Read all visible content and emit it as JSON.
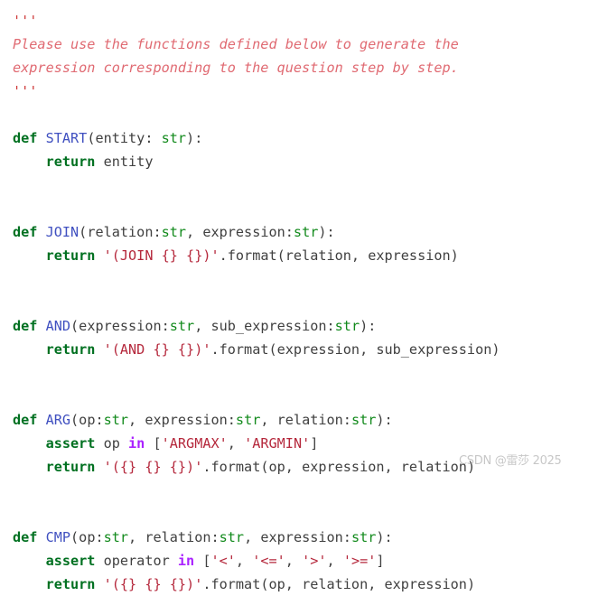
{
  "document": {
    "language": "python",
    "title": "Function definitions prompt",
    "background_color": "#ffffff",
    "default_text_color": "#404040"
  },
  "theme": {
    "keyword_color": "#007020",
    "operator_word_color": "#aa22ff",
    "function_name_color": "#4050c0",
    "type_color": "#128a1c",
    "string_color": "#b5283c",
    "docstring_color": "#e06a72",
    "docstring_quote_color": "#cf3a3a",
    "plain_color": "#404040"
  },
  "docstring": {
    "open_quotes": "'''",
    "close_quotes": "'''",
    "line1": "Please use the functions defined below to generate the",
    "line2": "expression corresponding to the question step by step."
  },
  "code": {
    "lines": [
      {
        "id": "l01",
        "tokens": [
          {
            "t": "'''",
            "c": "tok-docq"
          }
        ]
      },
      {
        "id": "l02",
        "tokens": [
          {
            "t": "Please use the functions defined below to generate the",
            "c": "tok-doc"
          }
        ]
      },
      {
        "id": "l03",
        "tokens": [
          {
            "t": "expression corresponding to the question step by step.",
            "c": "tok-doc"
          }
        ]
      },
      {
        "id": "l04",
        "tokens": [
          {
            "t": "'''",
            "c": "tok-docq"
          }
        ]
      },
      {
        "id": "l05",
        "tokens": []
      },
      {
        "id": "l06",
        "tokens": [
          {
            "t": "def",
            "c": "tok-kw"
          },
          {
            "t": " ",
            "c": "tok-plain"
          },
          {
            "t": "START",
            "c": "tok-fn"
          },
          {
            "t": "(entity: ",
            "c": "tok-plain"
          },
          {
            "t": "str",
            "c": "tok-type"
          },
          {
            "t": "):",
            "c": "tok-plain"
          }
        ]
      },
      {
        "id": "l07",
        "tokens": [
          {
            "t": "    ",
            "c": "tok-plain"
          },
          {
            "t": "return",
            "c": "tok-kw"
          },
          {
            "t": " entity",
            "c": "tok-plain"
          }
        ]
      },
      {
        "id": "l08",
        "tokens": []
      },
      {
        "id": "l09",
        "tokens": []
      },
      {
        "id": "l10",
        "tokens": [
          {
            "t": "def",
            "c": "tok-kw"
          },
          {
            "t": " ",
            "c": "tok-plain"
          },
          {
            "t": "JOIN",
            "c": "tok-fn"
          },
          {
            "t": "(relation:",
            "c": "tok-plain"
          },
          {
            "t": "str",
            "c": "tok-type"
          },
          {
            "t": ", expression:",
            "c": "tok-plain"
          },
          {
            "t": "str",
            "c": "tok-type"
          },
          {
            "t": "):",
            "c": "tok-plain"
          }
        ]
      },
      {
        "id": "l11",
        "tokens": [
          {
            "t": "    ",
            "c": "tok-plain"
          },
          {
            "t": "return",
            "c": "tok-kw"
          },
          {
            "t": " ",
            "c": "tok-plain"
          },
          {
            "t": "'(JOIN {} {})'",
            "c": "tok-str"
          },
          {
            "t": ".format(relation, expression)",
            "c": "tok-plain"
          }
        ]
      },
      {
        "id": "l12",
        "tokens": []
      },
      {
        "id": "l13",
        "tokens": []
      },
      {
        "id": "l14",
        "tokens": [
          {
            "t": "def",
            "c": "tok-kw"
          },
          {
            "t": " ",
            "c": "tok-plain"
          },
          {
            "t": "AND",
            "c": "tok-fn"
          },
          {
            "t": "(expression:",
            "c": "tok-plain"
          },
          {
            "t": "str",
            "c": "tok-type"
          },
          {
            "t": ", sub_expression:",
            "c": "tok-plain"
          },
          {
            "t": "str",
            "c": "tok-type"
          },
          {
            "t": "):",
            "c": "tok-plain"
          }
        ]
      },
      {
        "id": "l15",
        "tokens": [
          {
            "t": "    ",
            "c": "tok-plain"
          },
          {
            "t": "return",
            "c": "tok-kw"
          },
          {
            "t": " ",
            "c": "tok-plain"
          },
          {
            "t": "'(AND {} {})'",
            "c": "tok-str"
          },
          {
            "t": ".format(expression, sub_expression)",
            "c": "tok-plain"
          }
        ]
      },
      {
        "id": "l16",
        "tokens": []
      },
      {
        "id": "l17",
        "tokens": []
      },
      {
        "id": "l18",
        "tokens": [
          {
            "t": "def",
            "c": "tok-kw"
          },
          {
            "t": " ",
            "c": "tok-plain"
          },
          {
            "t": "ARG",
            "c": "tok-fn"
          },
          {
            "t": "(op:",
            "c": "tok-plain"
          },
          {
            "t": "str",
            "c": "tok-type"
          },
          {
            "t": ", expression:",
            "c": "tok-plain"
          },
          {
            "t": "str",
            "c": "tok-type"
          },
          {
            "t": ", relation:",
            "c": "tok-plain"
          },
          {
            "t": "str",
            "c": "tok-type"
          },
          {
            "t": "):",
            "c": "tok-plain"
          }
        ]
      },
      {
        "id": "l19",
        "tokens": [
          {
            "t": "    ",
            "c": "tok-plain"
          },
          {
            "t": "assert",
            "c": "tok-kw"
          },
          {
            "t": " op ",
            "c": "tok-plain"
          },
          {
            "t": "in",
            "c": "tok-op-word"
          },
          {
            "t": " [",
            "c": "tok-plain"
          },
          {
            "t": "'ARGMAX'",
            "c": "tok-str"
          },
          {
            "t": ", ",
            "c": "tok-plain"
          },
          {
            "t": "'ARGMIN'",
            "c": "tok-str"
          },
          {
            "t": "]",
            "c": "tok-plain"
          }
        ]
      },
      {
        "id": "l20",
        "tokens": [
          {
            "t": "    ",
            "c": "tok-plain"
          },
          {
            "t": "return",
            "c": "tok-kw"
          },
          {
            "t": " ",
            "c": "tok-plain"
          },
          {
            "t": "'({} {} {})'",
            "c": "tok-str"
          },
          {
            "t": ".format(op, expression, relation)",
            "c": "tok-plain"
          }
        ]
      },
      {
        "id": "l21",
        "tokens": []
      },
      {
        "id": "l22",
        "tokens": []
      },
      {
        "id": "l23",
        "tokens": [
          {
            "t": "def",
            "c": "tok-kw"
          },
          {
            "t": " ",
            "c": "tok-plain"
          },
          {
            "t": "CMP",
            "c": "tok-fn"
          },
          {
            "t": "(op:",
            "c": "tok-plain"
          },
          {
            "t": "str",
            "c": "tok-type"
          },
          {
            "t": ", relation:",
            "c": "tok-plain"
          },
          {
            "t": "str",
            "c": "tok-type"
          },
          {
            "t": ", expression:",
            "c": "tok-plain"
          },
          {
            "t": "str",
            "c": "tok-type"
          },
          {
            "t": "):",
            "c": "tok-plain"
          }
        ]
      },
      {
        "id": "l24",
        "tokens": [
          {
            "t": "    ",
            "c": "tok-plain"
          },
          {
            "t": "assert",
            "c": "tok-kw"
          },
          {
            "t": " operator ",
            "c": "tok-plain"
          },
          {
            "t": "in",
            "c": "tok-op-word"
          },
          {
            "t": " [",
            "c": "tok-plain"
          },
          {
            "t": "'<'",
            "c": "tok-str"
          },
          {
            "t": ", ",
            "c": "tok-plain"
          },
          {
            "t": "'<='",
            "c": "tok-str"
          },
          {
            "t": ", ",
            "c": "tok-plain"
          },
          {
            "t": "'>'",
            "c": "tok-str"
          },
          {
            "t": ", ",
            "c": "tok-plain"
          },
          {
            "t": "'>='",
            "c": "tok-str"
          },
          {
            "t": "]",
            "c": "tok-plain"
          }
        ]
      },
      {
        "id": "l25",
        "tokens": [
          {
            "t": "    ",
            "c": "tok-plain"
          },
          {
            "t": "return",
            "c": "tok-kw"
          },
          {
            "t": " ",
            "c": "tok-plain"
          },
          {
            "t": "'({} {} {})'",
            "c": "tok-str"
          },
          {
            "t": ".format(op, relation, expression)",
            "c": "tok-plain"
          }
        ]
      }
    ]
  },
  "watermark": {
    "text": "CSDN @雷莎 2025"
  }
}
